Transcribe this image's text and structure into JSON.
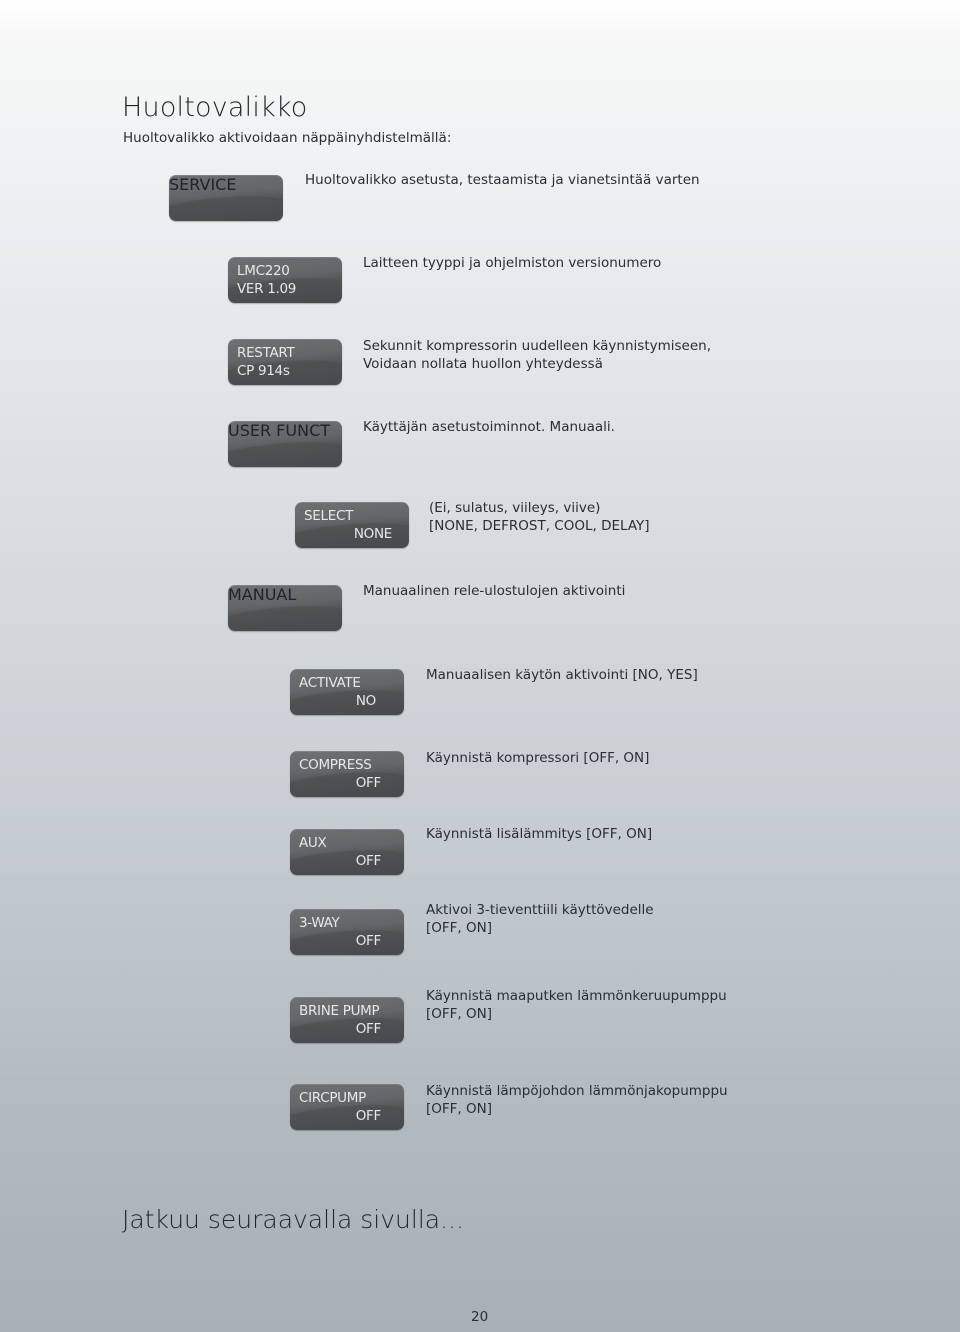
{
  "page": {
    "title": "Huoltovalikko",
    "subtitle": "Huoltovalikko aktivoidaan näppäinyhdistelmällä:",
    "continue_text": "Jatkuu seuraavalla sivulla...",
    "page_number": "20"
  },
  "menu_items": [
    {
      "id": "service",
      "line1": "SERVICE",
      "line2": "",
      "description": [
        "Huoltovalikko asetusta, testaamista ja vianetsintää varten"
      ]
    },
    {
      "id": "version",
      "line1": "LMC220",
      "line2": "VER 1.09",
      "description": [
        "Laitteen tyyppi ja ohjelmiston versionumero"
      ]
    },
    {
      "id": "restart",
      "line1": "RESTART",
      "line2": "CP 914s",
      "description": [
        "Sekunnit kompressorin uudelleen käynnistymiseen,",
        "Voidaan nollata huollon yhteydessä"
      ]
    },
    {
      "id": "user-funct",
      "line1": "USER FUNCT",
      "line2": "",
      "description": [
        "Käyttäjän asetustoiminnot. Manuaali."
      ]
    },
    {
      "id": "select",
      "line1": "SELECT",
      "line2": "NONE",
      "description": [
        "(Ei, sulatus, viileys, viive)",
        "[NONE, DEFROST, COOL, DELAY]"
      ]
    },
    {
      "id": "manual",
      "line1": "MANUAL",
      "line2": "",
      "description": [
        "Manuaalinen rele-ulostulojen aktivointi"
      ]
    },
    {
      "id": "activate",
      "line1": "ACTIVATE",
      "line2": "NO",
      "description": [
        "Manuaalisen käytön aktivointi [NO, YES]"
      ]
    },
    {
      "id": "compress",
      "line1": "COMPRESS",
      "line2": "OFF",
      "description": [
        "Käynnistä kompressori [OFF, ON]"
      ]
    },
    {
      "id": "aux",
      "line1": "AUX",
      "line2": "OFF",
      "description": [
        "Käynnistä lisälämmitys [OFF, ON]"
      ]
    },
    {
      "id": "3-way",
      "line1": "3-WAY",
      "line2": "OFF",
      "description": [
        "Aktivoi 3-tieventtiili käyttövedelle",
        "[OFF, ON]"
      ]
    },
    {
      "id": "brine-pump",
      "line1": "BRINE PUMP",
      "line2": "OFF",
      "description": [
        "Käynnistä maaputken lämmönkeruupumppu",
        "[OFF, ON]"
      ]
    },
    {
      "id": "circpump",
      "line1": "CIRCPUMP",
      "line2": "OFF",
      "description": [
        "Käynnistä lämpöjohdon lämmönjakopumppu",
        "[OFF, ON]"
      ]
    }
  ]
}
